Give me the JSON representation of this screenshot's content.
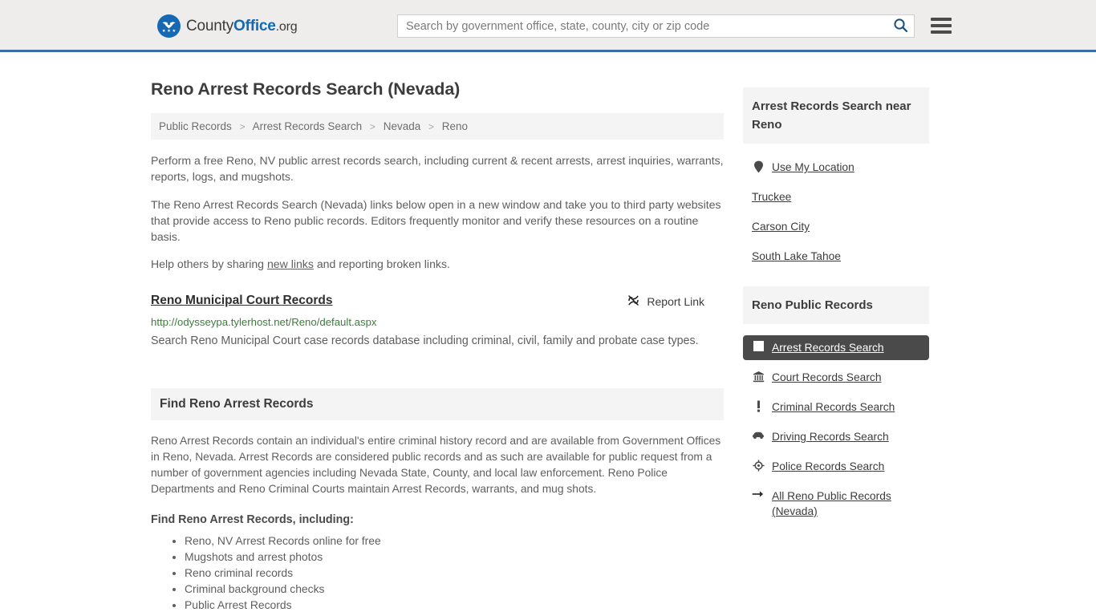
{
  "header": {
    "logo": {
      "icon": "eagle-shield-icon",
      "part1": "County",
      "part2": "Office",
      "part3": ".org"
    },
    "search": {
      "placeholder": "Search by government office, state, county, city or zip code",
      "value": "",
      "search_icon": "search-icon"
    },
    "menu_icon": "hamburger-menu-icon",
    "accent_color": "#3a6ea5"
  },
  "main": {
    "title": "Reno Arrest Records Search (Nevada)",
    "breadcrumb": {
      "separator": ">",
      "items": [
        {
          "label": "Public Records"
        },
        {
          "label": "Arrest Records Search"
        },
        {
          "label": "Nevada"
        },
        {
          "label": "Reno"
        }
      ]
    },
    "intro": {
      "p1": "Perform a free Reno, NV public arrest records search, including current & recent arrests, arrest inquiries, warrants, reports, logs, and mugshots.",
      "p2": "The Reno Arrest Records Search (Nevada) links below open in a new window and take you to third party websites that provide access to Reno public records. Editors frequently monitor and verify these resources on a routine basis.",
      "p3_before": "Help others by sharing ",
      "p3_link": "new links",
      "p3_after": " and reporting broken links."
    },
    "result": {
      "title": "Reno Municipal Court Records",
      "url": "http://odysseypa.tylerhost.net/Reno/default.aspx",
      "description": "Search Reno Municipal Court case records database including criminal, civil, family and probate case types.",
      "report_label": "Report Link",
      "report_icon": "broken-link-icon"
    },
    "section": {
      "heading": "Find Reno Arrest Records",
      "paragraph": "Reno Arrest Records contain an individual's entire criminal history record and are available from Government Offices in Reno, Nevada. Arrest Records are considered public records and as such are available for public request from a number of government agencies including Nevada State, County, and local law enforcement. Reno Police Departments and Reno Criminal Courts maintain Arrest Records, warrants, and mug shots.",
      "subheading": "Find Reno Arrest Records, including:",
      "bullets": [
        "Reno, NV Arrest Records online for free",
        "Mugshots and arrest photos",
        "Reno criminal records",
        "Criminal background checks",
        "Public Arrest Records"
      ]
    }
  },
  "sidebar": {
    "near_panel": {
      "heading": "Arrest Records Search near Reno",
      "items": [
        {
          "label": "Use My Location",
          "icon": "map-pin-icon"
        },
        {
          "label": "Truckee",
          "icon": ""
        },
        {
          "label": "Carson City",
          "icon": ""
        },
        {
          "label": "South Lake Tahoe",
          "icon": ""
        }
      ]
    },
    "records_panel": {
      "heading": "Reno Public Records",
      "active_color": "#4a4a4a",
      "items": [
        {
          "label": "Arrest Records Search",
          "icon": "fingerprint-card-icon",
          "active": true
        },
        {
          "label": "Court Records Search",
          "icon": "courthouse-icon",
          "active": false
        },
        {
          "label": "Criminal Records Search",
          "icon": "exclamation-icon",
          "active": false
        },
        {
          "label": "Driving Records Search",
          "icon": "car-icon",
          "active": false
        },
        {
          "label": "Police Records Search",
          "icon": "police-badge-icon",
          "active": false
        },
        {
          "label": "All Reno Public Records (Nevada)",
          "icon": "arrow-right-icon",
          "active": false
        }
      ]
    }
  }
}
